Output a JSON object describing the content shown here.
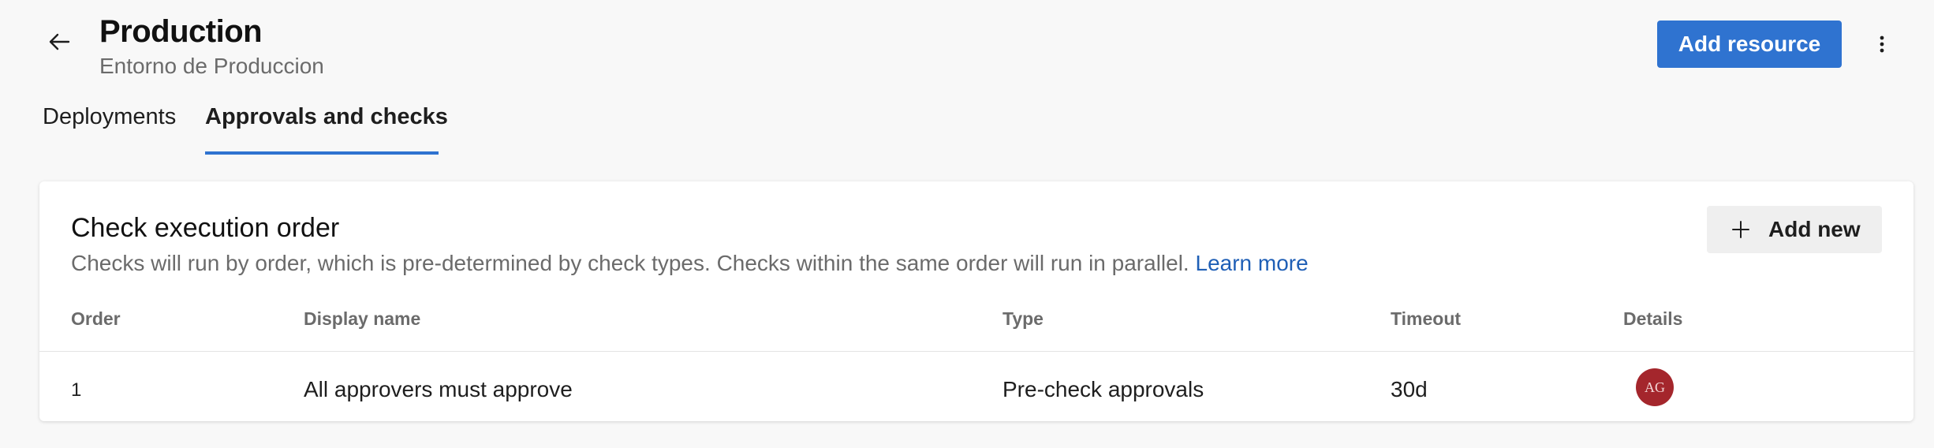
{
  "header": {
    "title": "Production",
    "subtitle": "Entorno de Produccion",
    "add_resource_label": "Add resource",
    "back_icon": "arrow-left-icon",
    "more_icon": "more-vertical-icon"
  },
  "tabs": [
    {
      "label": "Deployments",
      "selected": false
    },
    {
      "label": "Approvals and checks",
      "selected": true
    }
  ],
  "card": {
    "title": "Check execution order",
    "description": "Checks will run by order, which is pre-determined by check types. Checks within the same order will run in parallel.",
    "learn_more": "Learn more",
    "add_new_label": "Add new",
    "add_icon": "plus-icon",
    "columns": [
      "Order",
      "Display name",
      "Type",
      "Timeout",
      "Details"
    ],
    "rows": [
      {
        "order": "1",
        "display_name": "All approvers must approve",
        "type": "Pre-check approvals",
        "timeout": "30d",
        "details_avatar": "AG"
      }
    ]
  },
  "colors": {
    "accent": "#2f73d0",
    "link": "#1f5fb6",
    "avatar_bg": "#a4262c",
    "page_bg": "#f8f8f8"
  }
}
